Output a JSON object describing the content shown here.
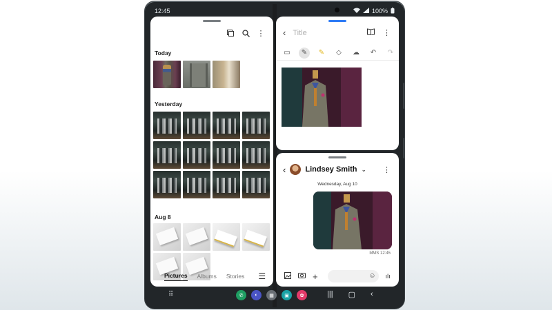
{
  "status": {
    "time": "12:45",
    "battery": "100%"
  },
  "gallery": {
    "sections": [
      "Today",
      "Yesterday",
      "Aug 8"
    ],
    "tabs": [
      "Pictures",
      "Albums",
      "Stories"
    ],
    "active_tab": "Pictures"
  },
  "notes": {
    "title_placeholder": "Title"
  },
  "messages": {
    "contact": "Lindsey Smith",
    "date": "Wednesday, Aug 10",
    "time": "MMS 12:45"
  },
  "dock": [
    {
      "icon": "phone-app-icon",
      "color": "#1f9e62"
    },
    {
      "icon": "internet-app-icon",
      "color": "#4a54c6"
    },
    {
      "icon": "apps-group-icon",
      "color": "#6a6f75"
    },
    {
      "icon": "calendar-app-icon",
      "color": "#1aa3a6"
    },
    {
      "icon": "galaxy-store-icon",
      "color": "#e23b6a"
    }
  ],
  "colors": {
    "accent": "#2f7cf6",
    "phone_body": "#222629"
  }
}
